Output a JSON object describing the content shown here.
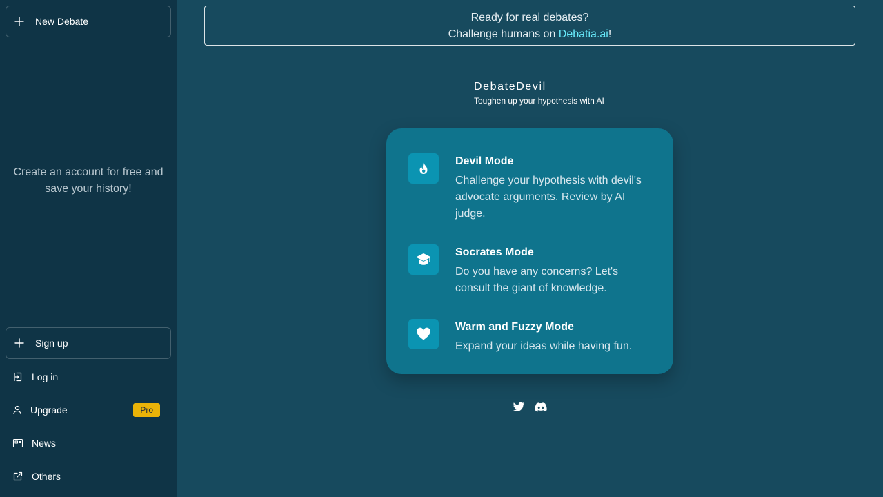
{
  "sidebar": {
    "new_debate": "New Debate",
    "message": "Create an account for free and save your history!",
    "signup": "Sign up",
    "login": "Log in",
    "upgrade": "Upgrade",
    "upgrade_badge": "Pro",
    "news": "News",
    "others": "Others"
  },
  "banner": {
    "line1": "Ready for real debates?",
    "line2_prefix": "Challenge humans on ",
    "link": "Debatia.ai",
    "line2_suffix": "!"
  },
  "brand": {
    "title": "DebateDevil",
    "subtitle": "Toughen up your hypothesis with AI"
  },
  "modes": [
    {
      "title": "Devil Mode",
      "desc": "Challenge your hypothesis with devil's advocate arguments. Review by AI judge.",
      "icon": "flame-icon"
    },
    {
      "title": "Socrates Mode",
      "desc": "Do you have any concerns? Let's consult the giant of knowledge.",
      "icon": "graduation-cap-icon"
    },
    {
      "title": "Warm and Fuzzy Mode",
      "desc": "Expand your ideas while having fun.",
      "icon": "heart-icon"
    }
  ],
  "colors": {
    "main_bg": "#174a5e",
    "sidebar_bg": "#0f3446",
    "card_bg": "#0f748d",
    "icon_tile": "#0b94b2",
    "link": "#67e8f9",
    "badge": "#eab308"
  },
  "socials": [
    "twitter-icon",
    "discord-icon"
  ]
}
